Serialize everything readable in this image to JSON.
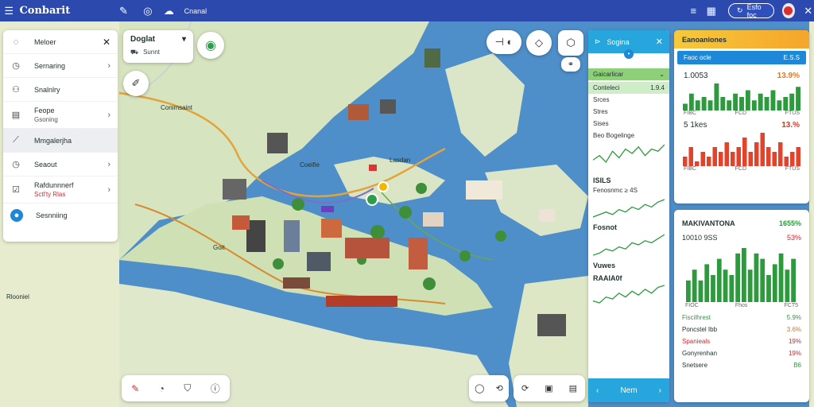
{
  "app": {
    "title": "Conbarit",
    "tab_label": "Cnanal",
    "user_pill": "Esfo foc",
    "colors": {
      "header": "#2c49ad",
      "accent": "#26a6dd",
      "alert": "#d9302b"
    }
  },
  "sidebar": {
    "items": [
      {
        "icon": "compass-icon",
        "label": "Meloer",
        "sub": "",
        "chevron": "✕"
      },
      {
        "icon": "clock-icon",
        "label": "Sernaring",
        "sub": "",
        "chevron": "›"
      },
      {
        "icon": "route-icon",
        "label": "Snalnlry",
        "sub": "",
        "chevron": ""
      },
      {
        "icon": "grid-icon",
        "label": "Feope",
        "sub": "Gsoning",
        "chevron": "›"
      },
      {
        "icon": "graph-icon",
        "label": "Mmgalerjha",
        "sub": "",
        "chevron": ""
      },
      {
        "icon": "clock-icon",
        "label": "Seaout",
        "sub": "",
        "chevron": "›"
      },
      {
        "icon": "check-icon",
        "label": "Rafdunnnerf",
        "sub": "Sctl'ty Rlas",
        "chevron": "›"
      },
      {
        "icon": "badge-icon",
        "label": "Sesnniing",
        "sub": "",
        "chevron": ""
      }
    ]
  },
  "search_card": {
    "title": "Doglat",
    "subtitle": "Sunnt"
  },
  "map": {
    "labels": [
      "Conimsaint",
      "Coeifie",
      "Goit",
      "Rlooniel",
      "Lasdan"
    ]
  },
  "mid_panel": {
    "title": "Sogina",
    "section": "Gaicarlicar",
    "section_value": "1.9.4",
    "sub_label": "Conteleci",
    "items": [
      "Srces",
      "Stres",
      "Sises",
      "Beo Bogelinge"
    ],
    "stats": [
      {
        "label": "ISILS",
        "sub": "Fenosnmc ≥ 4S"
      },
      {
        "label": "Fosnot",
        "sub": ""
      },
      {
        "label": "Vuwes",
        "sub": ""
      },
      {
        "label": "RAAIA0f",
        "sub": ""
      }
    ],
    "footer": "Nem",
    "spark_data": [
      [
        4,
        6,
        3,
        8,
        5,
        9,
        7,
        10,
        6,
        9,
        8,
        11
      ],
      [
        3,
        4,
        5,
        4,
        6,
        5,
        7,
        6,
        8,
        7,
        9,
        10
      ],
      [
        2,
        3,
        5,
        4,
        6,
        5,
        8,
        7,
        9,
        8,
        10,
        12
      ],
      [
        3,
        2,
        5,
        4,
        7,
        5,
        8,
        6,
        9,
        7,
        10,
        11
      ]
    ]
  },
  "right_panel_top": {
    "title": "Eanoaniones",
    "blue_row": {
      "left": "Faoc ocle",
      "right": "E.S.S"
    },
    "stat1": {
      "value": "1.0053",
      "pct": "13.9%"
    },
    "stat1_axis": [
      "FIBC",
      "FCD",
      "FTUS"
    ],
    "stat2": {
      "value": "5 1kes",
      "pct": "13.%"
    },
    "stat2_axis": [
      "FIBC",
      "FCD",
      "FTUS"
    ],
    "bars_green": [
      2,
      5,
      3,
      4,
      3,
      8,
      4,
      3,
      5,
      4,
      6,
      3,
      5,
      4,
      6,
      3,
      4,
      5,
      7
    ],
    "bars_red": [
      2,
      4,
      1,
      3,
      2,
      4,
      3,
      5,
      3,
      4,
      6,
      3,
      5,
      7,
      4,
      3,
      5,
      2,
      3,
      4
    ]
  },
  "right_panel_bottom": {
    "title": "MAKIVANTONA",
    "title_pct": "1655%",
    "value": "10010 9SS",
    "value_pct": "53%",
    "bars": [
      4,
      6,
      4,
      7,
      5,
      8,
      6,
      5,
      9,
      10,
      6,
      9,
      8,
      5,
      7,
      9,
      6,
      8
    ],
    "axis": [
      "FIOC",
      "Fhos",
      "FCT5"
    ],
    "rows": [
      {
        "label": "Fiscilhrest",
        "value": "5.9%",
        "cls": "green"
      },
      {
        "label": "Poncstel Ibb",
        "value": "3.6%",
        "cls": "orange"
      },
      {
        "label": "Spanieals",
        "value": "19%",
        "cls": "red"
      },
      {
        "label": "Gonyrenhan",
        "value": "19%",
        "cls": "red"
      },
      {
        "label": "Snetsere",
        "value": "B6",
        "cls": "green"
      }
    ]
  }
}
